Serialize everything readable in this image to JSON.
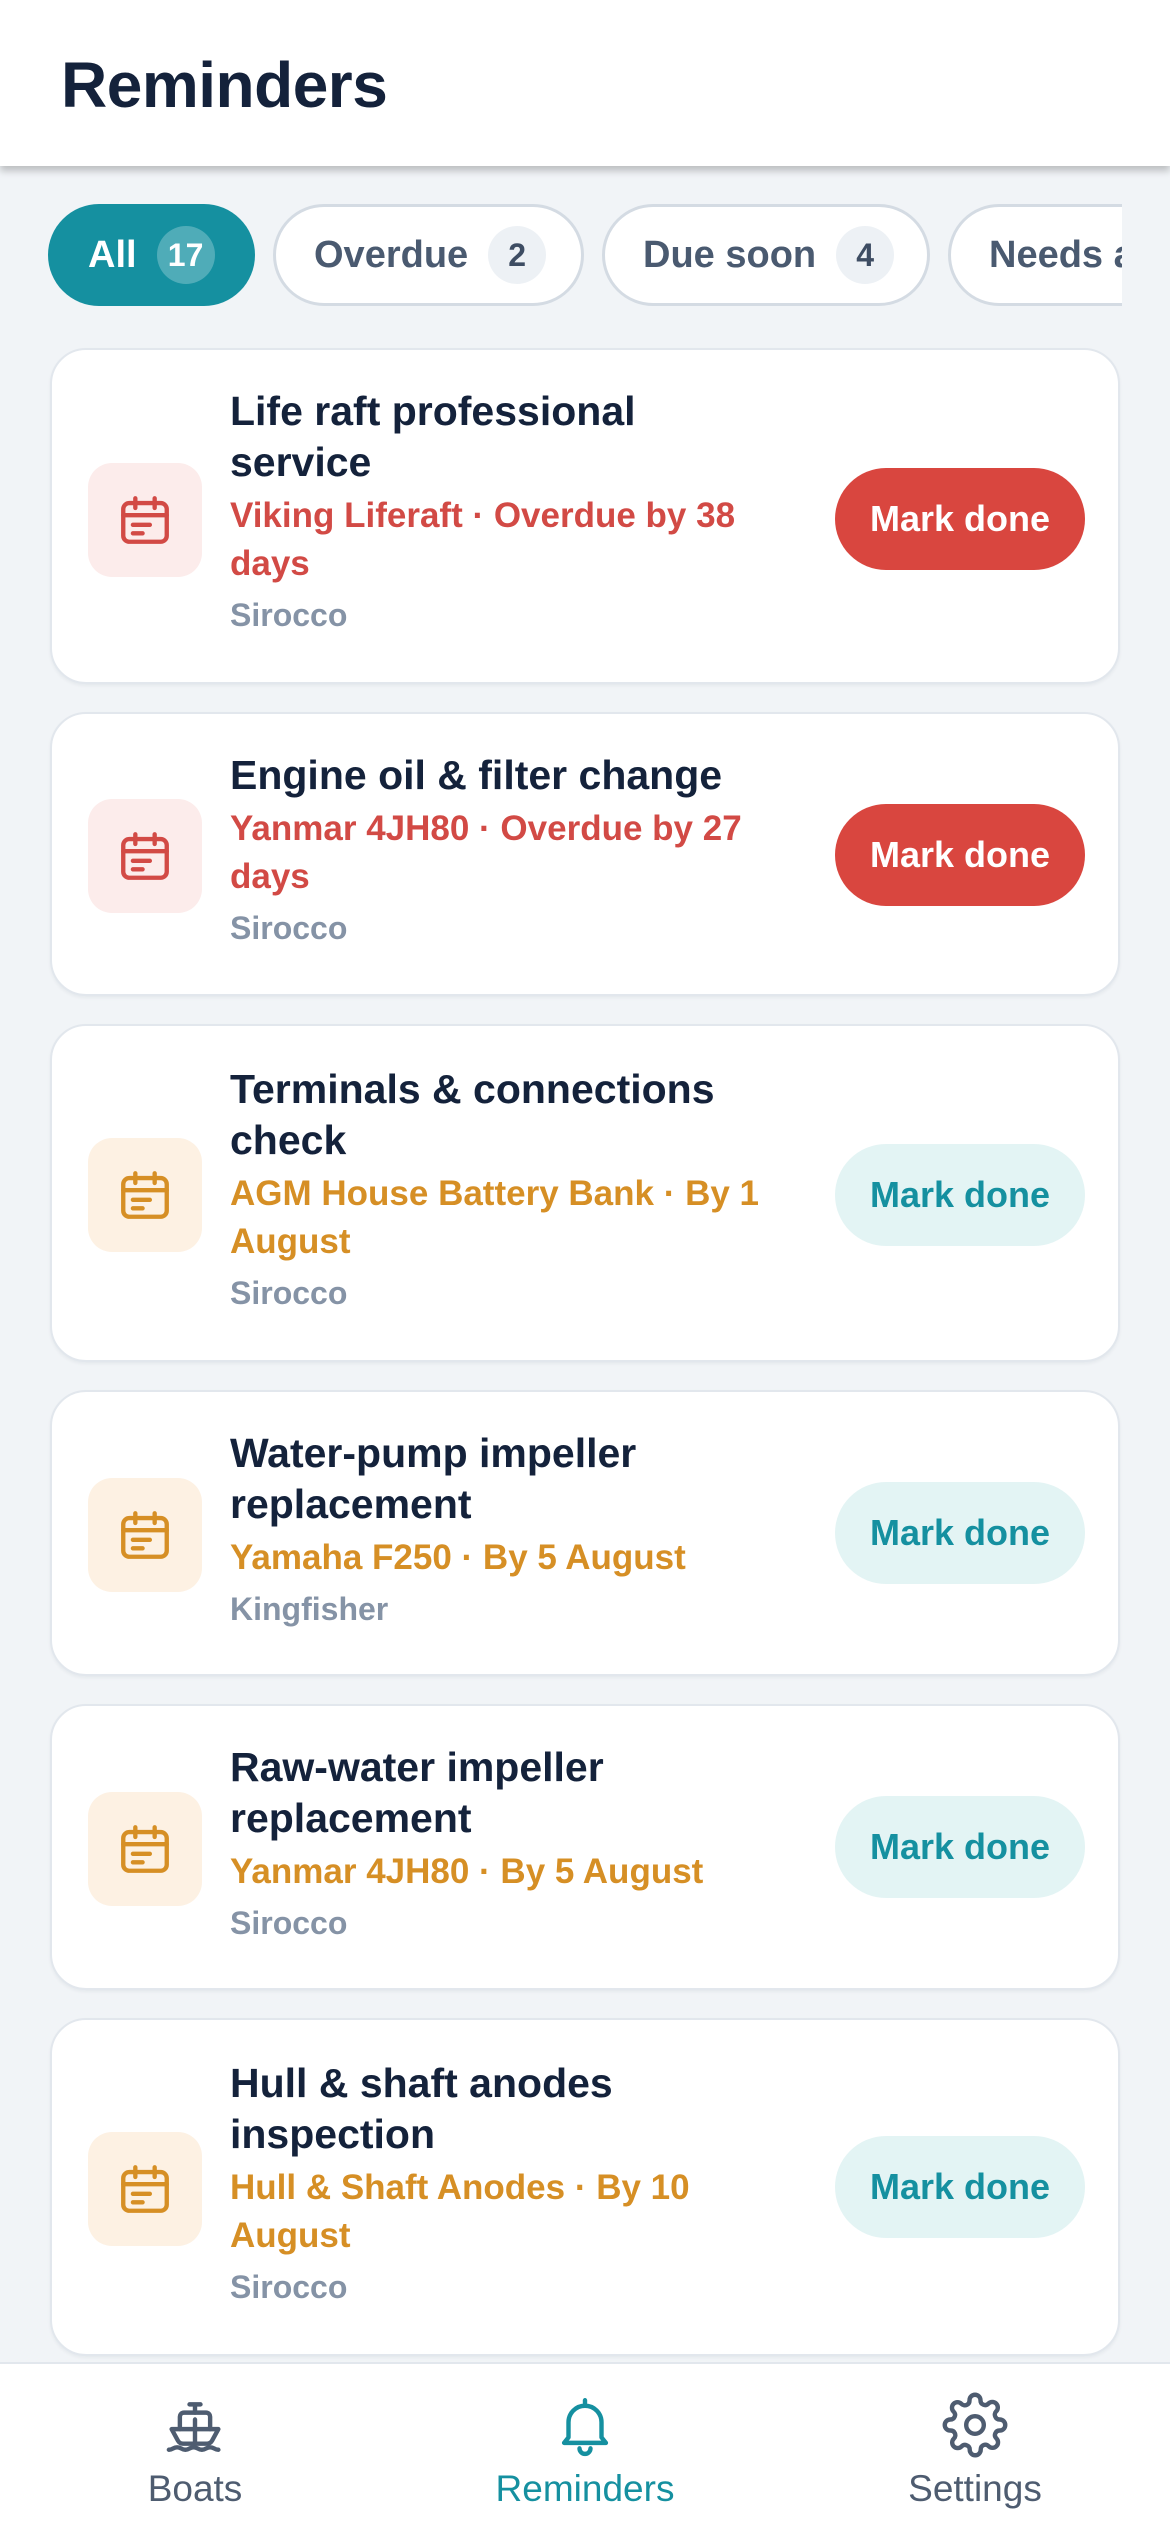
{
  "header": {
    "title": "Reminders"
  },
  "filters": [
    {
      "label": "All",
      "count": "17",
      "active": true
    },
    {
      "label": "Overdue",
      "count": "2",
      "active": false
    },
    {
      "label": "Due soon",
      "count": "4",
      "active": false
    },
    {
      "label": "Needs attention",
      "count": "",
      "active": false
    }
  ],
  "reminders": [
    {
      "title_lines": [
        "Life raft professional",
        "service"
      ],
      "detail_lines": [
        "Viking Liferaft · Overdue by 38",
        "days"
      ],
      "boat": "Sirocco",
      "status": "overdue",
      "action_label": "Mark done",
      "icon": "calendar-icon"
    },
    {
      "title_lines": [
        "Engine oil & filter change"
      ],
      "detail_lines": [
        "Yanmar 4JH80 · Overdue by 27",
        "days"
      ],
      "boat": "Sirocco",
      "status": "overdue",
      "action_label": "Mark done",
      "icon": "calendar-icon"
    },
    {
      "title_lines": [
        "Terminals & connections",
        "check"
      ],
      "detail_lines": [
        "AGM House Battery Bank · By 1",
        "August"
      ],
      "boat": "Sirocco",
      "status": "due-soon",
      "action_label": "Mark done",
      "icon": "calendar-icon"
    },
    {
      "title_lines": [
        "Water-pump impeller",
        "replacement"
      ],
      "detail_lines": [
        "Yamaha F250 · By 5 August"
      ],
      "boat": "Kingfisher",
      "status": "due-soon",
      "action_label": "Mark done",
      "icon": "calendar-icon"
    },
    {
      "title_lines": [
        "Raw-water impeller",
        "replacement"
      ],
      "detail_lines": [
        "Yanmar 4JH80 · By 5 August"
      ],
      "boat": "Sirocco",
      "status": "due-soon",
      "action_label": "Mark done",
      "icon": "calendar-icon"
    },
    {
      "title_lines": [
        "Hull & shaft anodes",
        "inspection"
      ],
      "detail_lines": [
        "Hull & Shaft Anodes · By 10",
        "August"
      ],
      "boat": "Sirocco",
      "status": "due-soon",
      "action_label": "Mark done",
      "icon": "calendar-icon"
    }
  ],
  "nav": [
    {
      "label": "Boats",
      "icon": "boat-icon",
      "active": false
    },
    {
      "label": "Reminders",
      "icon": "bell-icon",
      "active": true
    },
    {
      "label": "Settings",
      "icon": "gear-icon",
      "active": false
    }
  ],
  "colors": {
    "accent": "#1590a0",
    "overdue": "#d9463f",
    "due_soon": "#d68f25",
    "muted": "#8593a6",
    "title": "#14223b"
  }
}
